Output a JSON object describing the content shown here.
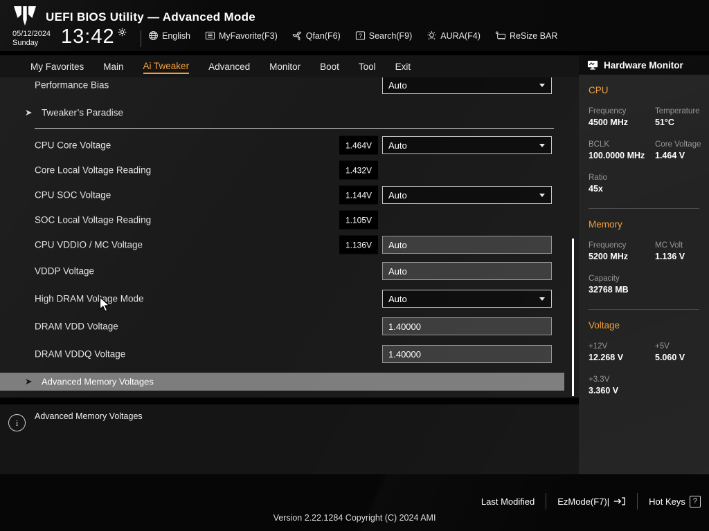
{
  "titlebar": {
    "app_title": "UEFI BIOS Utility — Advanced Mode",
    "date": "05/12/2024",
    "day": "Sunday",
    "time": "13:42",
    "toolbar": [
      {
        "icon": "globe-icon",
        "label": "English"
      },
      {
        "icon": "list-icon",
        "label": "MyFavorite(F3)"
      },
      {
        "icon": "fan-icon",
        "label": "Qfan(F6)"
      },
      {
        "icon": "question-box-icon",
        "label": "Search(F9)"
      },
      {
        "icon": "aura-lamp-icon",
        "label": "AURA(F4)"
      },
      {
        "icon": "chip-icon",
        "label": "ReSize BAR"
      }
    ]
  },
  "menu": {
    "tabs": [
      {
        "label": "My Favorites",
        "active": false
      },
      {
        "label": "Main",
        "active": false
      },
      {
        "label": "Ai Tweaker",
        "active": true
      },
      {
        "label": "Advanced",
        "active": false
      },
      {
        "label": "Monitor",
        "active": false
      },
      {
        "label": "Boot",
        "active": false
      },
      {
        "label": "Tool",
        "active": false
      },
      {
        "label": "Exit",
        "active": false
      }
    ]
  },
  "settings": {
    "rows": [
      {
        "label": "Performance Bias",
        "type": "dropdown",
        "value": "Auto"
      },
      {
        "label": "Tweaker’s Paradise",
        "type": "submenu"
      },
      {
        "type": "divider"
      },
      {
        "label": "CPU Core Voltage",
        "type": "dropdown",
        "value": "Auto",
        "reading": "1.464V"
      },
      {
        "label": "Core Local Voltage Reading",
        "type": "reading",
        "reading": "1.432V"
      },
      {
        "label": "CPU SOC Voltage",
        "type": "dropdown",
        "value": "Auto",
        "reading": "1.144V"
      },
      {
        "label": "SOC Local Voltage Reading",
        "type": "reading",
        "reading": "1.105V"
      },
      {
        "label": "CPU VDDIO / MC Voltage",
        "type": "input",
        "value": "Auto",
        "reading": "1.136V"
      },
      {
        "label": "VDDP Voltage",
        "type": "input",
        "value": "Auto"
      },
      {
        "label": "High DRAM Voltage Mode",
        "type": "dropdown",
        "value": "Auto"
      },
      {
        "label": "DRAM VDD Voltage",
        "type": "input",
        "value": "1.40000"
      },
      {
        "label": "DRAM VDDQ Voltage",
        "type": "input",
        "value": "1.40000"
      },
      {
        "label": "Advanced Memory Voltages",
        "type": "submenu",
        "selected": true
      }
    ],
    "description": "Advanced Memory Voltages"
  },
  "hardware_monitor": {
    "title": "Hardware Monitor",
    "sections": [
      {
        "title": "CPU",
        "pairs": [
          {
            "label": "Frequency",
            "value": "4500 MHz"
          },
          {
            "label": "Temperature",
            "value": "51°C"
          },
          {
            "label": "BCLK",
            "value": "100.0000 MHz"
          },
          {
            "label": "Core Voltage",
            "value": "1.464 V"
          },
          {
            "label": "Ratio",
            "value": "45x"
          }
        ]
      },
      {
        "title": "Memory",
        "pairs": [
          {
            "label": "Frequency",
            "value": "5200 MHz"
          },
          {
            "label": "MC Volt",
            "value": "1.136 V"
          },
          {
            "label": "Capacity",
            "value": "32768 MB"
          }
        ]
      },
      {
        "title": "Voltage",
        "pairs": [
          {
            "label": "+12V",
            "value": "12.268 V"
          },
          {
            "label": "+5V",
            "value": "5.060 V"
          },
          {
            "label": "+3.3V",
            "value": "3.360 V"
          }
        ]
      }
    ]
  },
  "footer": {
    "last_modified": "Last Modified",
    "ezmode": "EzMode(F7)|",
    "hotkeys": "Hot Keys",
    "hotkeys_badge": "?",
    "version": "Version 2.22.1284 Copyright (C) 2024 AMI"
  },
  "colors": {
    "accent": "#f2a03c",
    "highlight_row": "#7d7d7d"
  }
}
